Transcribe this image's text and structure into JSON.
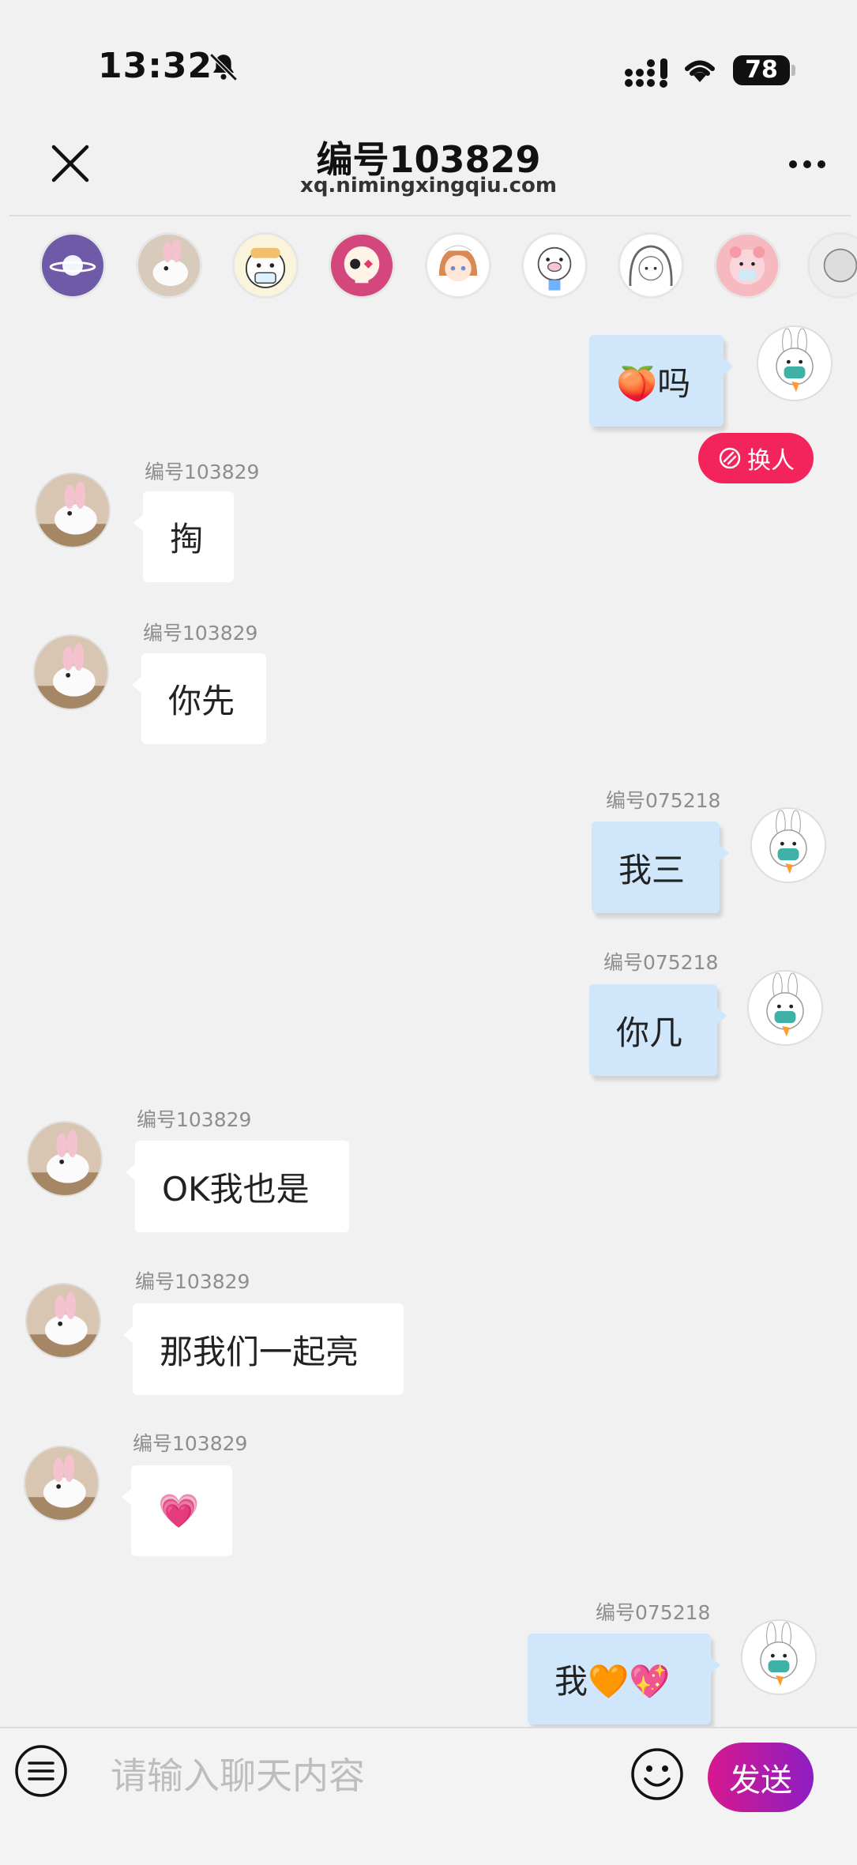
{
  "status_bar": {
    "time": "13:32",
    "battery": "78",
    "icons": [
      "bell-muted-icon",
      "cellular-signal-icon",
      "wifi-icon",
      "battery-icon"
    ]
  },
  "header": {
    "title": "编号103829",
    "subtitle": "xq.nimingxingqiu.com",
    "close_icon": "close-icon",
    "more_icon": "more-icon"
  },
  "avatar_strip": {
    "items": [
      "planet",
      "bunny-cat",
      "mask-face",
      "skull",
      "anime-girl",
      "pig",
      "sketch-girl",
      "pink-pig",
      "partial"
    ]
  },
  "messages": [
    {
      "side": "right",
      "name": "",
      "text": "🍑吗"
    },
    {
      "side": "left",
      "name": "编号103829",
      "text": "掏"
    },
    {
      "side": "left",
      "name": "编号103829",
      "text": "你先"
    },
    {
      "side": "right",
      "name": "编号075218",
      "text": "我三"
    },
    {
      "side": "right",
      "name": "编号075218",
      "text": "你几"
    },
    {
      "side": "left",
      "name": "编号103829",
      "text": "OK我也是"
    },
    {
      "side": "left",
      "name": "编号103829",
      "text": "那我们一起亮"
    },
    {
      "side": "left",
      "name": "编号103829",
      "text": "💗"
    },
    {
      "side": "right",
      "name": "编号075218",
      "text": "我🧡💖"
    }
  ],
  "swap_button": {
    "label": "换人",
    "icon": "swap-icon"
  },
  "composer": {
    "placeholder": "请输入聊天内容",
    "send_label": "发送",
    "menu_icon": "menu-icon",
    "emoji_icon": "emoji-icon"
  },
  "colors": {
    "background": "#f1f1f1",
    "my_bubble": "#cfe6fb",
    "other_bubble": "#ffffff",
    "swap_button": "#f2245b",
    "send_gradient_start": "#d7188e",
    "send_gradient_end": "#8d1ec2"
  }
}
